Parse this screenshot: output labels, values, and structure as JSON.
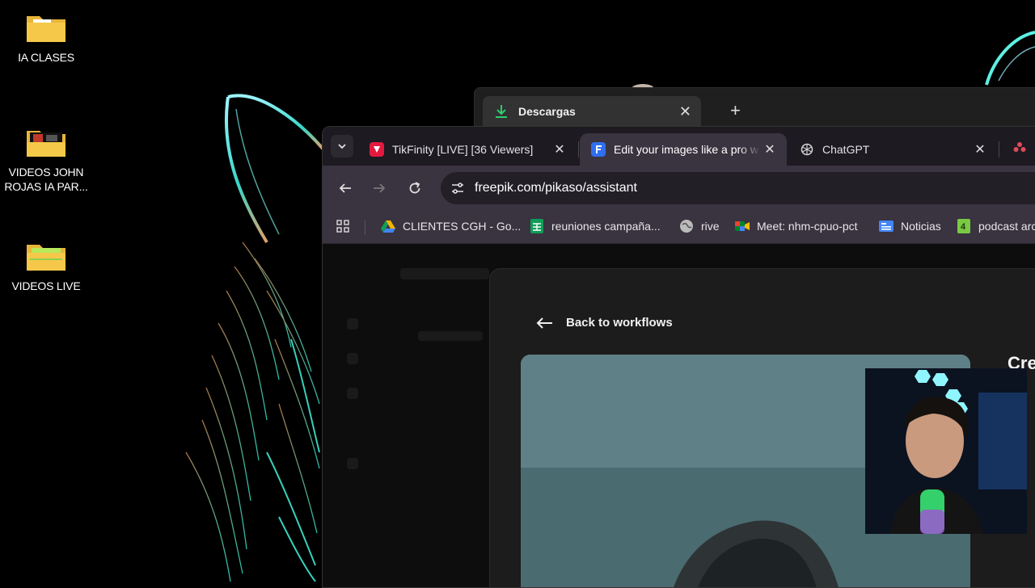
{
  "desktop": {
    "icons": [
      {
        "label": "IA CLASES"
      },
      {
        "label": "VIDEOS JOHN\nROJAS IA PAR..."
      },
      {
        "label": "VIDEOS LIVE"
      }
    ]
  },
  "downloads_window": {
    "tab_title": "Descargas"
  },
  "browser": {
    "tabs": [
      {
        "title": "TikFinity [LIVE] [36 Viewers]",
        "favicon_color": "#e3193f"
      },
      {
        "title": "Edit your images like a pro w",
        "favicon_color": "#2f6ff0",
        "active": true
      },
      {
        "title": "ChatGPT",
        "favicon_color": "#cfcfcf"
      }
    ],
    "url": "freepik.com/pikaso/assistant",
    "bookmarks": [
      {
        "label": "CLIENTES CGH - Go..."
      },
      {
        "label": "reuniones campaña..."
      },
      {
        "label": "rive"
      },
      {
        "label": "Meet: nhm-cpuo-pct"
      },
      {
        "label": "Noticias"
      },
      {
        "label": "podcast arc"
      }
    ]
  },
  "page": {
    "back_link": "Back to workflows",
    "side_heading": "Cre"
  },
  "colors": {
    "accent_cyan": "#3de8d0",
    "tab_active_bg": "#3a3340",
    "download_icon": "#2ecc71"
  }
}
